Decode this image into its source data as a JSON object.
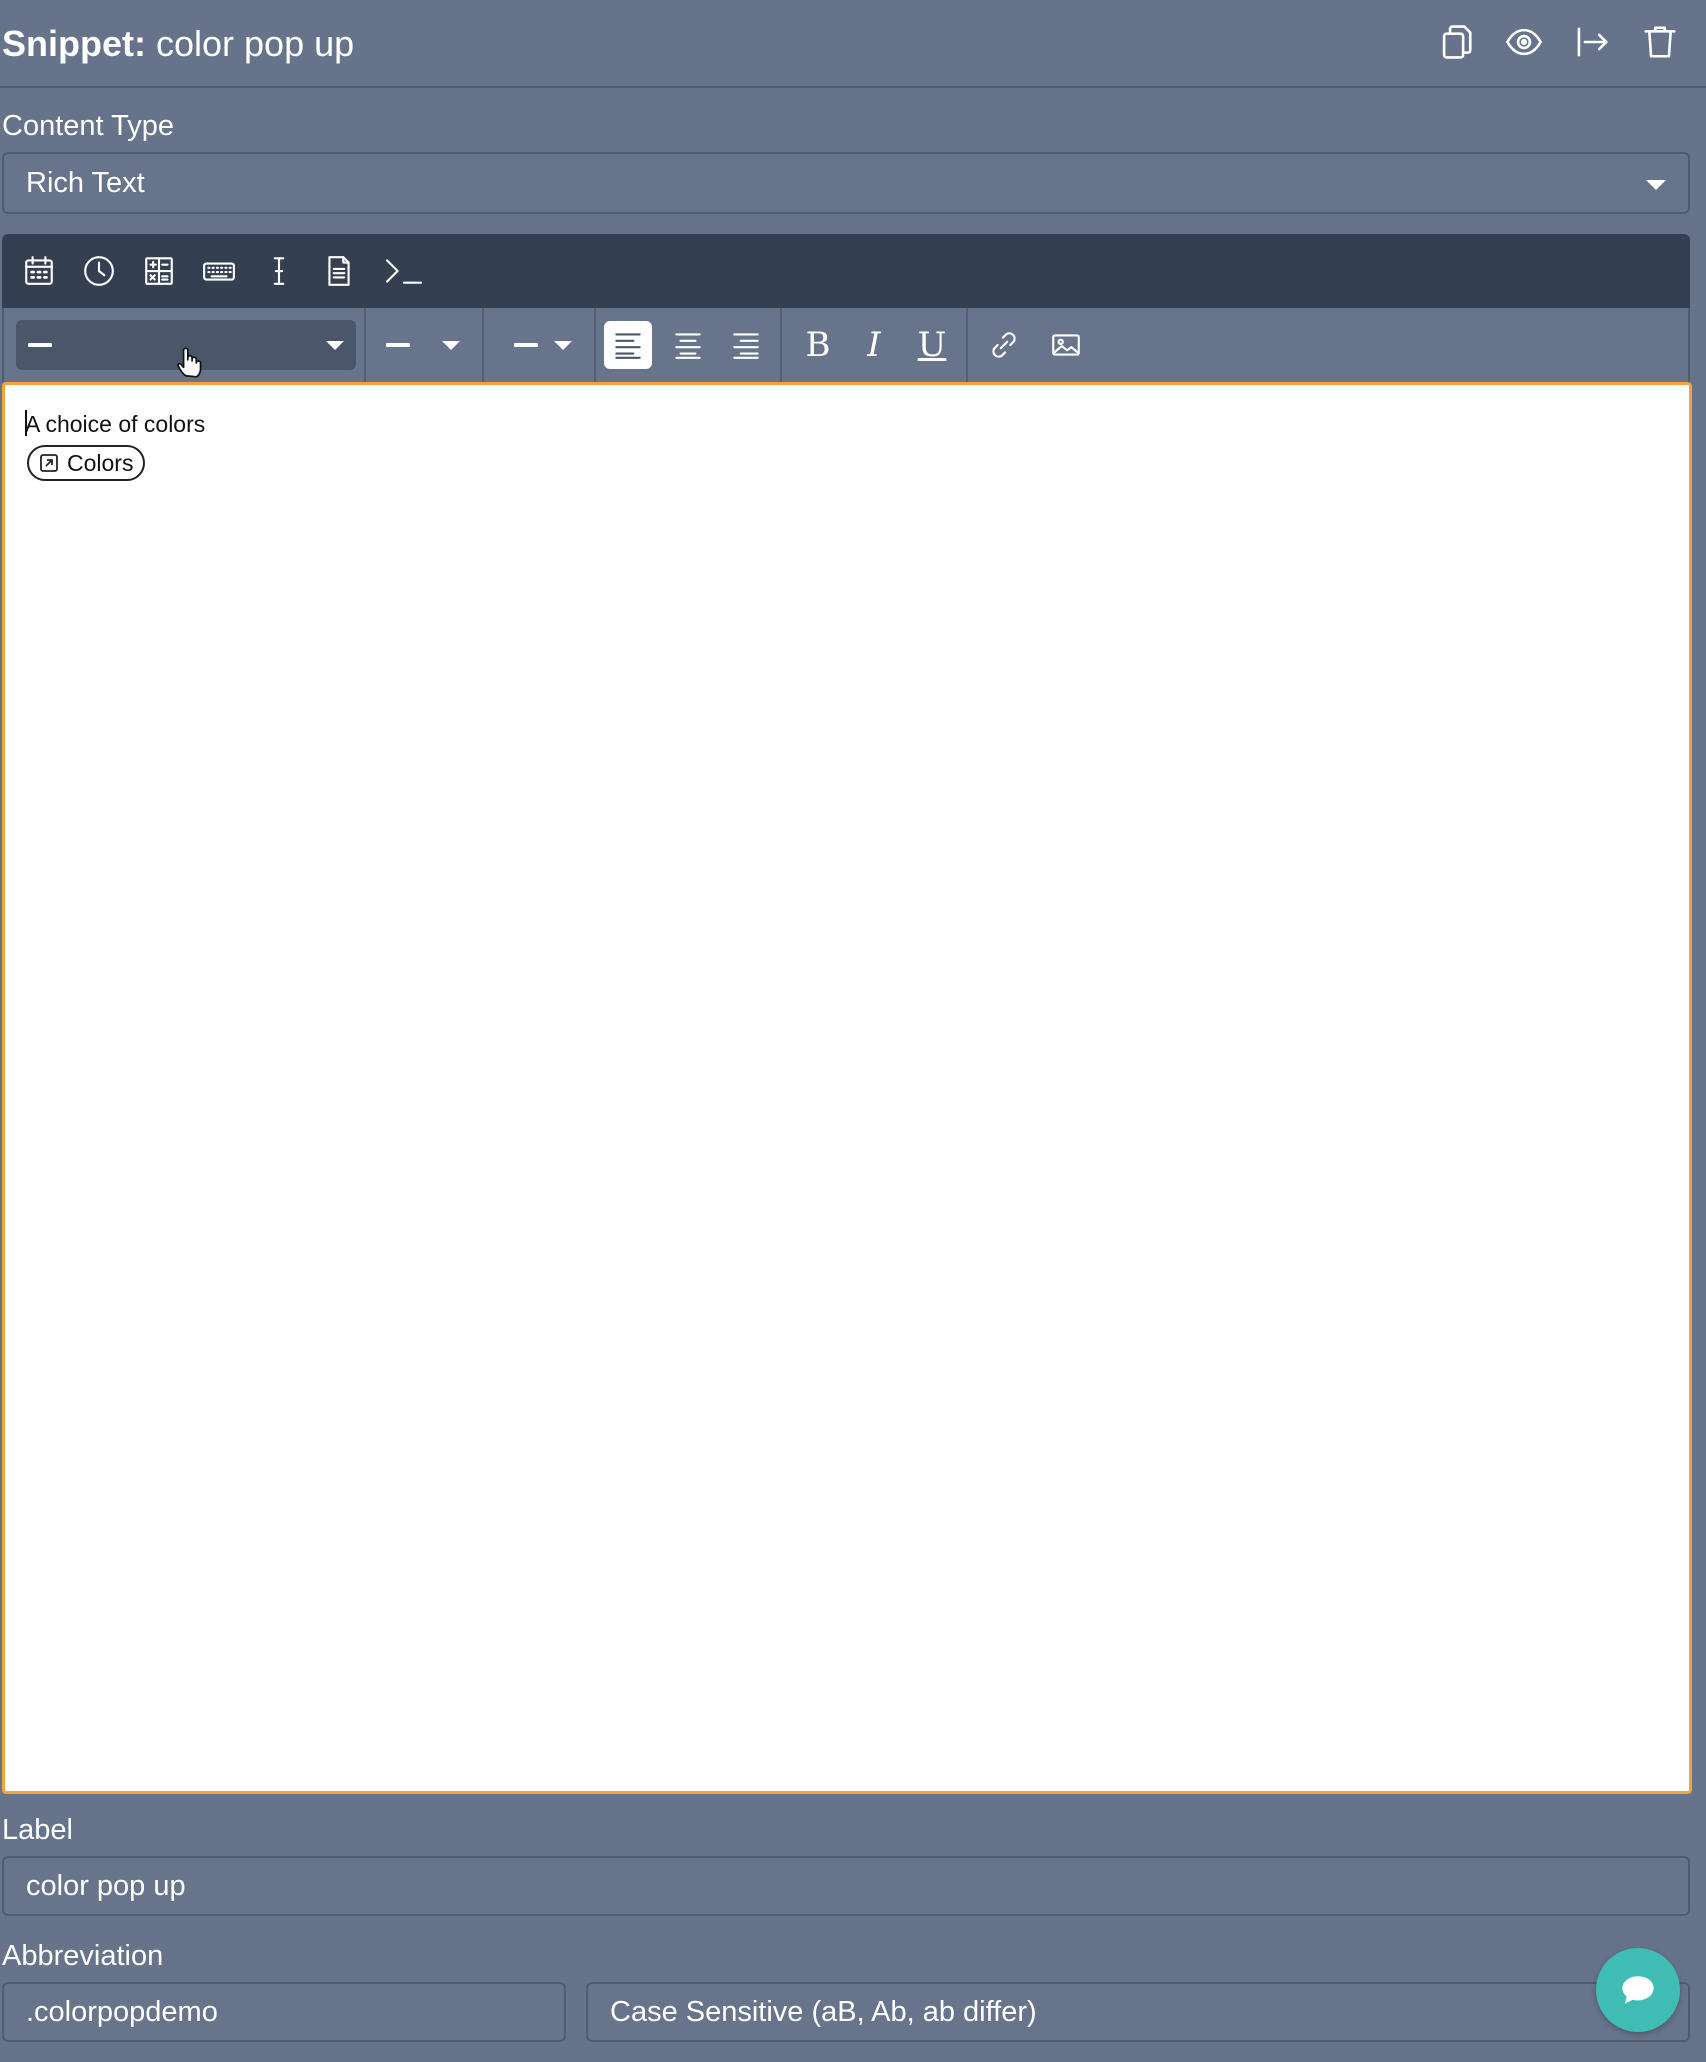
{
  "header": {
    "title_prefix": "Snippet:",
    "title_name": "color pop up",
    "actions": [
      "copy-icon",
      "eye-icon",
      "share-icon",
      "trash-icon"
    ]
  },
  "content_type": {
    "label": "Content Type",
    "value": "Rich Text"
  },
  "toolbar": {
    "insert_tools": [
      "calendar-icon",
      "clock-icon",
      "formula-icon",
      "keyboard-icon",
      "text-cursor-icon",
      "document-icon",
      "terminal-icon"
    ],
    "format_select_value": "",
    "alignment_active": "left",
    "text_styles": [
      "B",
      "I",
      "U"
    ]
  },
  "editor": {
    "text": "A choice of colors",
    "chip_label": "Colors"
  },
  "label_field": {
    "label": "Label",
    "value": "color pop up"
  },
  "abbreviation": {
    "label": "Abbreviation",
    "value": ".colorpopdemo",
    "case_mode": "Case Sensitive (aB, Ab, ab differ)"
  },
  "colors": {
    "background": "#67738a",
    "toolbar_dark": "#353f52",
    "editor_focus": "#f5a33b",
    "chat_button": "#3fbcb4"
  }
}
